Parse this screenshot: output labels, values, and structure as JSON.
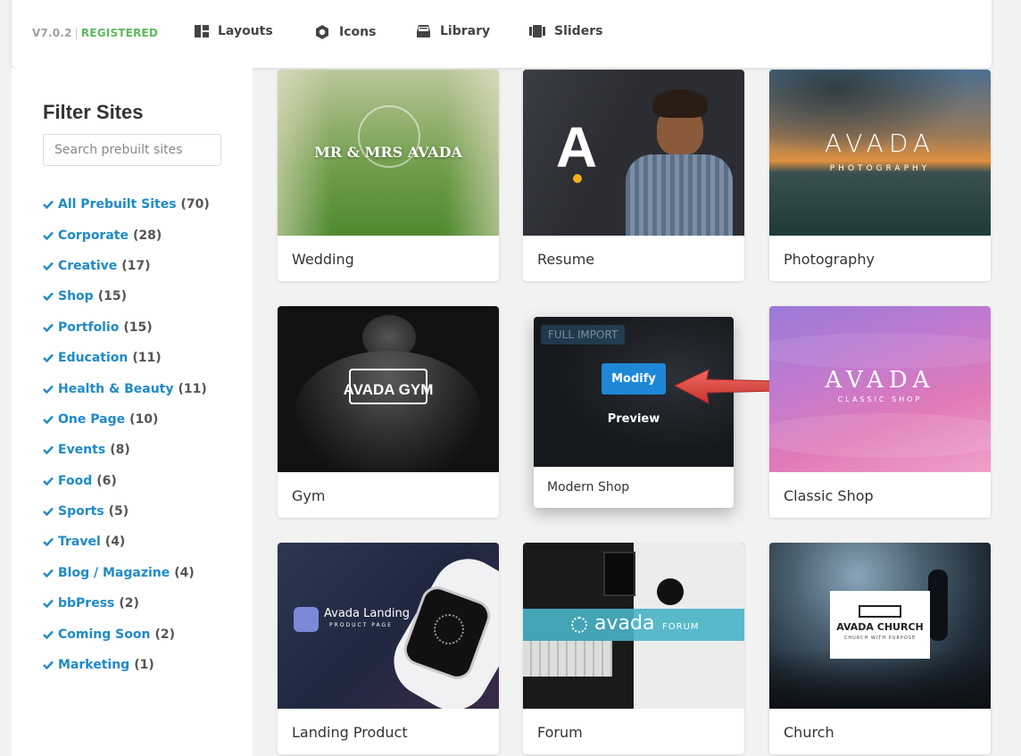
{
  "header": {
    "version": "V7.0.2",
    "separator": "|",
    "status": "REGISTERED",
    "nav": [
      {
        "label": "Layouts",
        "icon": "layouts-icon"
      },
      {
        "label": "Icons",
        "icon": "icons-icon"
      },
      {
        "label": "Library",
        "icon": "library-icon"
      },
      {
        "label": "Sliders",
        "icon": "sliders-icon"
      }
    ]
  },
  "sidebar": {
    "title": "Filter Sites",
    "search_placeholder": "Search prebuilt sites",
    "filters": [
      {
        "name": "All Prebuilt Sites",
        "count": "(70)"
      },
      {
        "name": "Corporate",
        "count": "(28)"
      },
      {
        "name": "Creative",
        "count": "(17)"
      },
      {
        "name": "Shop",
        "count": "(15)"
      },
      {
        "name": "Portfolio",
        "count": "(15)"
      },
      {
        "name": "Education",
        "count": "(11)"
      },
      {
        "name": "Health & Beauty",
        "count": "(11)"
      },
      {
        "name": "One Page",
        "count": "(10)"
      },
      {
        "name": "Events",
        "count": "(8)"
      },
      {
        "name": "Food",
        "count": "(6)"
      },
      {
        "name": "Sports",
        "count": "(5)"
      },
      {
        "name": "Travel",
        "count": "(4)"
      },
      {
        "name": "Blog / Magazine",
        "count": "(4)"
      },
      {
        "name": "bbPress",
        "count": "(2)"
      },
      {
        "name": "Coming Soon",
        "count": "(2)"
      },
      {
        "name": "Marketing",
        "count": "(1)"
      }
    ]
  },
  "sites": {
    "wedding": {
      "label": "Wedding",
      "thumb_text": "MR & MRS AVADA"
    },
    "resume": {
      "label": "Resume",
      "thumb_text": "A"
    },
    "photography": {
      "label": "Photography",
      "thumb_text": "AVADA",
      "thumb_sub": "PHOTOGRAPHY"
    },
    "gym": {
      "label": "Gym",
      "thumb_text": "AVADA GYM"
    },
    "modern_shop": {
      "label": "Modern Shop",
      "badge": "FULL IMPORT",
      "modify": "Modify",
      "preview": "Preview"
    },
    "classic_shop": {
      "label": "Classic Shop",
      "thumb_text": "AVADA",
      "thumb_sub": "CLASSIC SHOP"
    },
    "landing_product": {
      "label": "Landing Product",
      "thumb_text": "Avada Landing",
      "thumb_sub": "PRODUCT PAGE"
    },
    "forum": {
      "label": "Forum",
      "thumb_text": "avada",
      "thumb_sub": "FORUM"
    },
    "church": {
      "label": "Church",
      "thumb_text": "AVADA CHURCH",
      "thumb_sub": "CHURCH WITH PURPOSE"
    }
  },
  "colors": {
    "accent": "#1e8ac9",
    "registered": "#5cb85c",
    "modify_button": "#1e88d8",
    "arrow": "#d9403a"
  }
}
